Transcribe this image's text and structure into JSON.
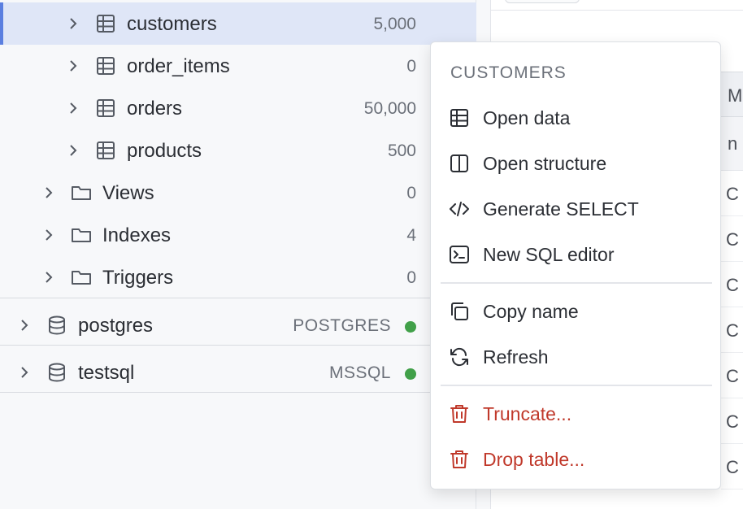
{
  "tree": {
    "tables": [
      {
        "name": "customers",
        "count": "5,000",
        "selected": true
      },
      {
        "name": "order_items",
        "count": "0"
      },
      {
        "name": "orders",
        "count": "50,000"
      },
      {
        "name": "products",
        "count": "500"
      }
    ],
    "folders": [
      {
        "name": "Views",
        "count": "0"
      },
      {
        "name": "Indexes",
        "count": "4"
      },
      {
        "name": "Triggers",
        "count": "0"
      }
    ],
    "connections": [
      {
        "name": "postgres",
        "type": "POSTGRES",
        "status_color": "#41a049"
      },
      {
        "name": "testsql",
        "type": "MSSQL",
        "status_color": "#41a049"
      }
    ]
  },
  "grid": {
    "header": "M",
    "subheader": "n",
    "cells": [
      "C",
      "C",
      "C",
      "C",
      "C",
      "C",
      "C"
    ]
  },
  "menu": {
    "title": "CUSTOMERS",
    "items": [
      {
        "label": "Open data",
        "icon": "table-icon"
      },
      {
        "label": "Open structure",
        "icon": "columns-icon"
      },
      {
        "label": "Generate SELECT",
        "icon": "code-icon"
      },
      {
        "label": "New SQL editor",
        "icon": "terminal-icon"
      },
      {
        "label": "Copy name",
        "icon": "copy-icon"
      },
      {
        "label": "Refresh",
        "icon": "refresh-icon"
      },
      {
        "label": "Truncate...",
        "icon": "trash-icon",
        "danger": true
      },
      {
        "label": "Drop table...",
        "icon": "trash-icon",
        "danger": true
      }
    ]
  },
  "colors": {
    "accent": "#5b7fe0",
    "danger": "#c0392b",
    "online": "#41a049"
  }
}
